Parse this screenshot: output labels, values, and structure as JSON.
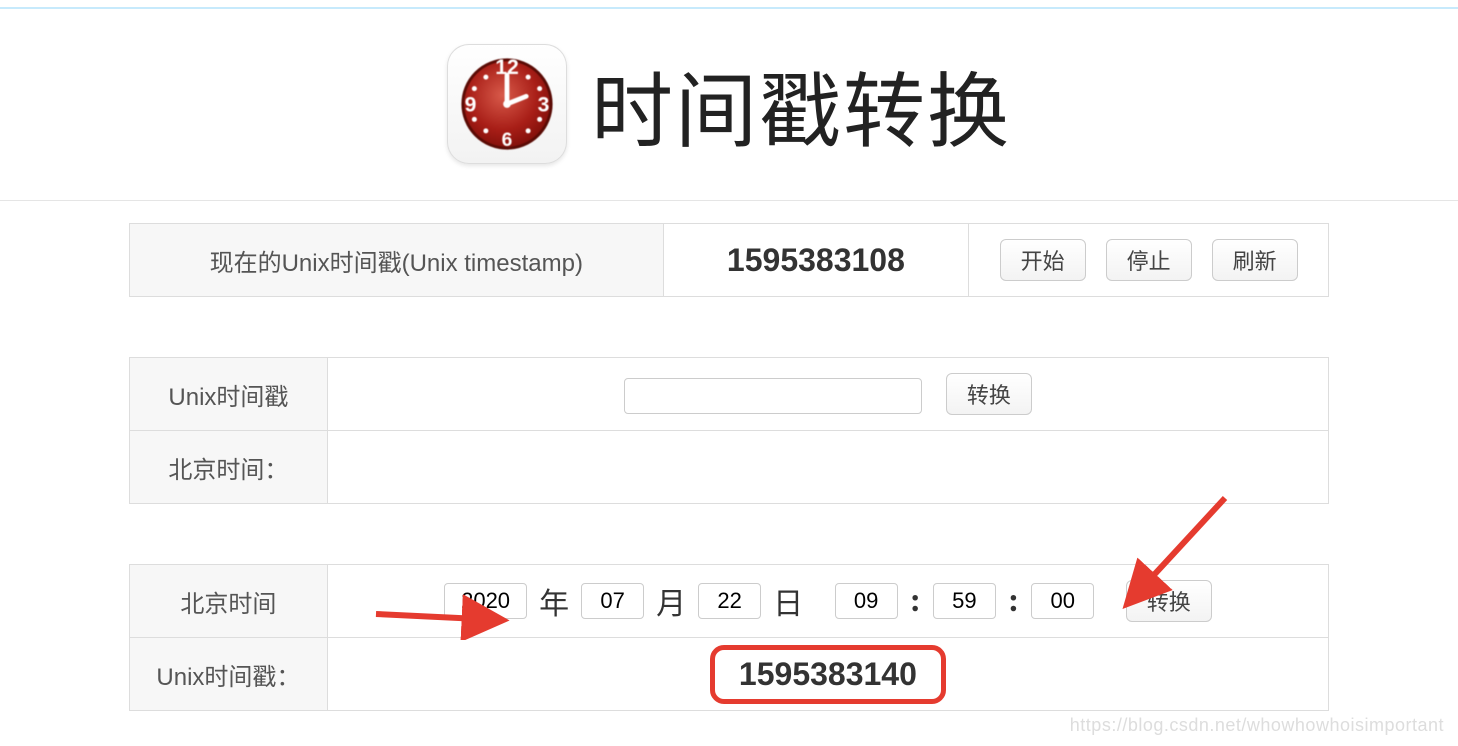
{
  "header": {
    "title": "时间戳转换"
  },
  "now_row": {
    "label": "现在的Unix时间戳(Unix timestamp)",
    "value": "1595383108",
    "buttons": {
      "start": "开始",
      "stop": "停止",
      "refresh": "刷新"
    }
  },
  "to_time": {
    "input_label": "Unix时间戳",
    "input_value": "",
    "convert": "转换",
    "output_label": "北京时间：",
    "output_value": ""
  },
  "to_ts": {
    "input_label": "北京时间",
    "year": "2020",
    "month": "07",
    "day": "22",
    "hour": "09",
    "minute": "59",
    "second": "00",
    "year_lbl": "年",
    "month_lbl": "月",
    "day_lbl": "日",
    "convert": "转换",
    "output_label": "Unix时间戳：",
    "output_value": "1595383140"
  },
  "watermark": "https://blog.csdn.net/whowhowhoisimportant"
}
